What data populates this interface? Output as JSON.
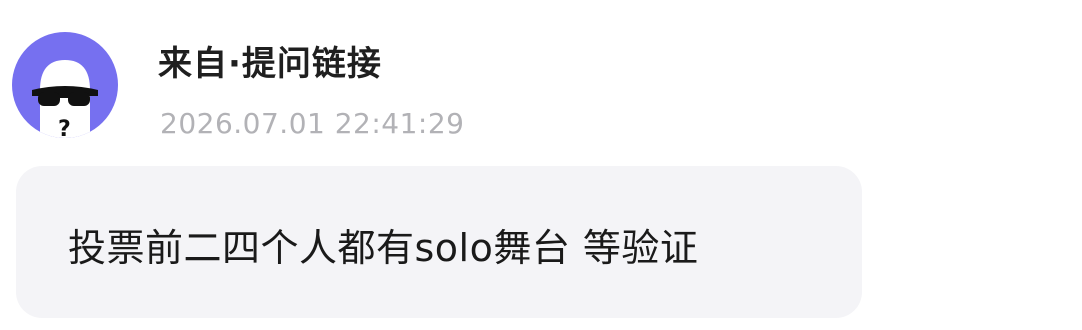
{
  "sender": {
    "avatar_icon": "sunglasses-ghost-icon",
    "avatar_bg": "#7670f0",
    "name": "来自·提问链接",
    "timestamp": "2026.07.01 22:41:29"
  },
  "message": {
    "text": "投票前二四个人都有solo舞台 等验证",
    "bubble_bg": "#f4f4f7"
  }
}
